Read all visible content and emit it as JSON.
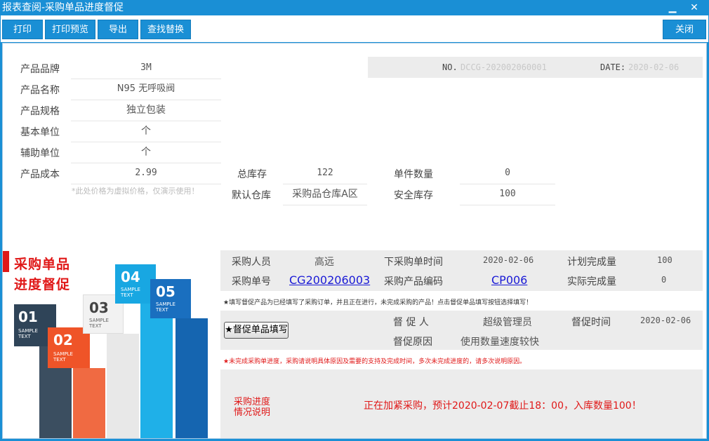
{
  "window": {
    "title": "报表查阅-采购单品进度督促",
    "minimize_glyph": "▁",
    "close_glyph": "✕"
  },
  "toolbar": {
    "print": "打印",
    "print_preview": "打印预览",
    "export": "导出",
    "find_replace": "查找替换",
    "close": "关闭"
  },
  "product": {
    "brand_label": "产品品牌",
    "brand": "3M",
    "name_label": "产品名称",
    "name": "N95 无呼吸阀",
    "spec_label": "产品规格",
    "spec": "独立包装",
    "base_unit_label": "基本单位",
    "base_unit": "个",
    "aux_unit_label": "辅助单位",
    "aux_unit": "个",
    "cost_label": "产品成本",
    "cost": "2.99",
    "cost_hint": "*此处价格为虚拟价格，仅演示使用！",
    "total_stock_label": "总库存",
    "total_stock": "122",
    "default_wh_label": "默认仓库",
    "default_wh": "采购品仓库A区",
    "unit_qty_label": "单件数量",
    "unit_qty": "0",
    "safety_stock_label": "安全库存",
    "safety_stock": "100"
  },
  "header": {
    "no_label": "NO.",
    "no": "DCCG-202002060001",
    "date_label": "DATE:",
    "date": "2020-02-06"
  },
  "side": {
    "title_line1": "采购单品",
    "title_line2": "进度督促",
    "blocks": [
      {
        "num": "01",
        "text": "SAMPLE TEXT",
        "color": "#2f4458"
      },
      {
        "num": "02",
        "text": "SAMPLE TEXT",
        "color": "#ef5428"
      },
      {
        "num": "03",
        "text": "SAMPLE TEXT",
        "color": "#f2f2f2"
      },
      {
        "num": "04",
        "text": "SAMPLE TEXT",
        "color": "#18a7e2"
      },
      {
        "num": "05",
        "text": "SAMPLE TEXT",
        "color": "#1a6fbf"
      }
    ]
  },
  "purchase": {
    "buyer_label": "采购人员",
    "buyer": "高远",
    "order_time_label": "下采购单时间",
    "order_time": "2020-02-06",
    "plan_qty_label": "计划完成量",
    "plan_qty": "100",
    "order_no_label": "采购单号",
    "order_no": "CG200206003",
    "code_label": "采购产品编码",
    "code": "CP006",
    "actual_qty_label": "实际完成量",
    "actual_qty": "0",
    "note": "★填写督促产品为已经填写了采购订单，并且正在进行，未完成采购的产品！点击督促单品填写按钮选择填写！"
  },
  "urge": {
    "button": "★督促单品填写",
    "person_label": "督 促 人",
    "person": "超级管理员",
    "time_label": "督促时间",
    "time": "2020-02-06",
    "reason_label": "督促原因",
    "reason": "使用数量速度较快",
    "note": "★未完成采购单进度，采购请说明具体原因及需要的支持及完成时间，多次未完成进度的，请多次说明原因。"
  },
  "progress": {
    "label_line1": "采购进度",
    "label_line2": "情况说明",
    "text": "正在加紧采购，预计2020-02-07截止18：00，入库数量100！"
  },
  "colors": {
    "accent": "#1a8fd5",
    "red": "#e01818",
    "band": "#ececec"
  }
}
